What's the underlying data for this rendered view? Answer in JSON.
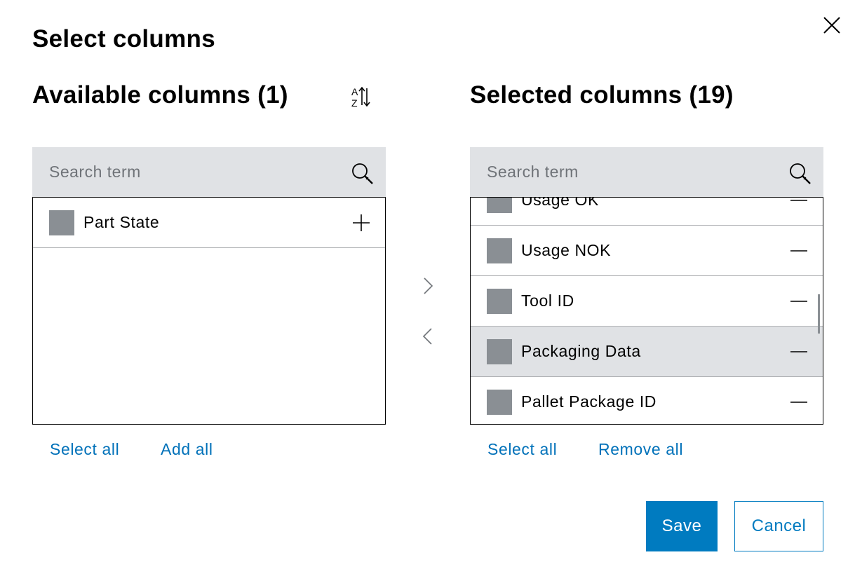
{
  "dialog": {
    "title": "Select columns",
    "close_icon": "close-icon"
  },
  "available": {
    "heading": "Available columns (1)",
    "sort_icon": "sort-az-icon",
    "search": {
      "placeholder": "Search term",
      "value": ""
    },
    "items": [
      {
        "label": "Part State",
        "action_icon": "plus-icon"
      }
    ],
    "select_all_label": "Select all",
    "add_all_label": "Add all"
  },
  "selected": {
    "heading": "Selected columns (19)",
    "search": {
      "placeholder": "Search term",
      "value": ""
    },
    "items": [
      {
        "label": "Usage OK",
        "action_icon": "minus-icon"
      },
      {
        "label": "Usage NOK",
        "action_icon": "minus-icon"
      },
      {
        "label": "Tool ID",
        "action_icon": "minus-icon"
      },
      {
        "label": "Packaging Data",
        "action_icon": "minus-icon",
        "highlighted": true
      },
      {
        "label": "Pallet Package ID",
        "action_icon": "minus-icon"
      }
    ],
    "select_all_label": "Select all",
    "remove_all_label": "Remove all"
  },
  "transfer": {
    "add_icon": "chevron-right-icon",
    "remove_icon": "chevron-left-icon"
  },
  "footer": {
    "save_label": "Save",
    "cancel_label": "Cancel"
  },
  "colors": {
    "accent": "#007bc0",
    "link": "#0071b9",
    "search_bg": "#e0e2e5",
    "chip": "#8a8f94"
  }
}
